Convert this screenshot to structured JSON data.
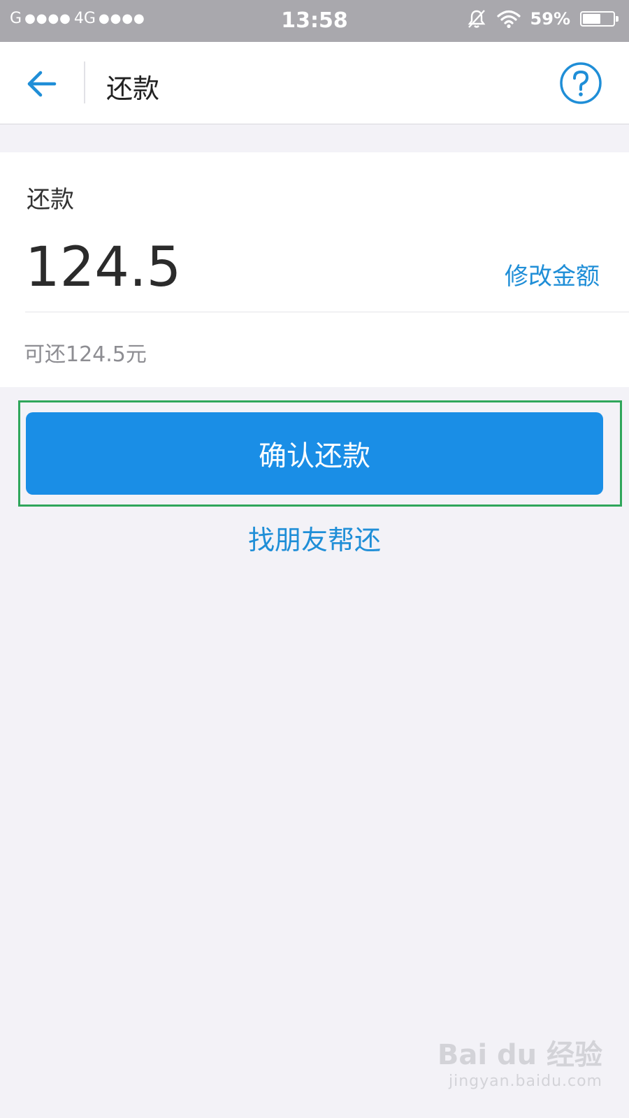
{
  "status_bar": {
    "carrier": "G",
    "network": "4G",
    "signal_dots_1": "●●●●",
    "signal_dots_2": "●●●●",
    "time": "13:58",
    "battery_percent": "59%",
    "battery_level": 0.59
  },
  "header": {
    "title": "还款",
    "back_icon": "arrow-left-icon",
    "help_icon": "question-circle-icon"
  },
  "repay": {
    "label": "还款",
    "amount": "124.5",
    "edit_link": "修改金额",
    "available_text": "可还124.5元"
  },
  "actions": {
    "confirm_label": "确认还款",
    "friend_link": "找朋友帮还"
  },
  "watermark": {
    "logo": "Bai du 经验",
    "url": "jingyan.baidu.com"
  },
  "colors": {
    "accent": "#1a8ee6",
    "link": "#1f8ed7",
    "highlight_frame": "#2fa65b",
    "status_bar": "#a9a8ad",
    "background": "#f3f2f7"
  }
}
